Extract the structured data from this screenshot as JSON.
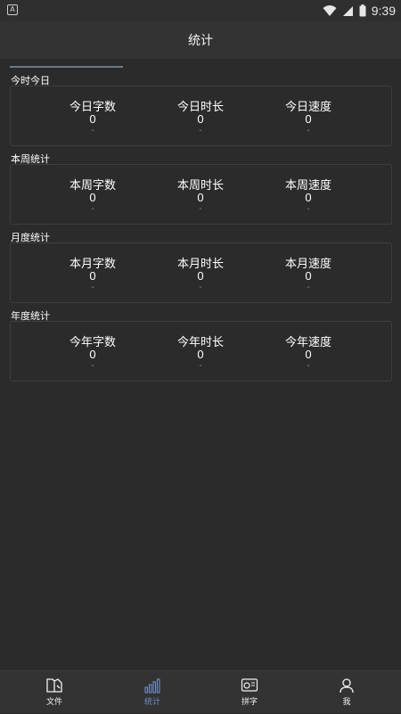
{
  "status_bar": {
    "time": "9:39",
    "app_icon_letter": "A"
  },
  "header": {
    "title": "统计"
  },
  "sections": [
    {
      "title": "今时今日",
      "stats": [
        {
          "label": "今日字数",
          "value": "0",
          "sub": "-"
        },
        {
          "label": "今日时长",
          "value": "0",
          "sub": "-"
        },
        {
          "label": "今日速度",
          "value": "0",
          "sub": "-"
        }
      ]
    },
    {
      "title": "本周统计",
      "stats": [
        {
          "label": "本周字数",
          "value": "0",
          "sub": "-"
        },
        {
          "label": "本周时长",
          "value": "0",
          "sub": "-"
        },
        {
          "label": "本周速度",
          "value": "0",
          "sub": "-"
        }
      ]
    },
    {
      "title": "月度统计",
      "stats": [
        {
          "label": "本月字数",
          "value": "0",
          "sub": "-"
        },
        {
          "label": "本月时长",
          "value": "0",
          "sub": "-"
        },
        {
          "label": "本月速度",
          "value": "0",
          "sub": "-"
        }
      ]
    },
    {
      "title": "年度统计",
      "stats": [
        {
          "label": "今年字数",
          "value": "0",
          "sub": "-"
        },
        {
          "label": "今年时长",
          "value": "0",
          "sub": "-"
        },
        {
          "label": "今年速度",
          "value": "0",
          "sub": "-"
        }
      ]
    }
  ],
  "bottom_nav": [
    {
      "label": "文件",
      "icon": "files-icon",
      "active": false
    },
    {
      "label": "统计",
      "icon": "bar-chart-icon",
      "active": true
    },
    {
      "label": "拼字",
      "icon": "compose-icon",
      "active": false
    },
    {
      "label": "我",
      "icon": "person-icon",
      "active": false
    }
  ],
  "colors": {
    "background": "#2b2b2b",
    "bar": "#333333",
    "accent": "#6f8fc9",
    "card_border": "#3e3e3e"
  }
}
